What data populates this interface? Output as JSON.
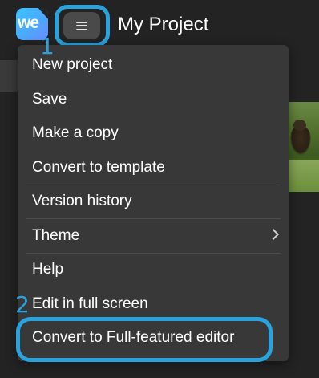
{
  "app": {
    "logo_text": "we",
    "project_title": "My Project"
  },
  "colors": {
    "accent": "#29a3de",
    "menu_bg": "#383838",
    "page_bg": "#232323"
  },
  "annotations": {
    "step1": "1",
    "step2": "2"
  },
  "menu": {
    "items": [
      {
        "label": "New project"
      },
      {
        "label": "Save"
      },
      {
        "label": "Make a copy"
      },
      {
        "label": "Convert to template"
      },
      {
        "label": "Version history"
      },
      {
        "label": "Theme",
        "has_submenu": true,
        "icon": "chevron-right-icon"
      },
      {
        "label": "Help"
      },
      {
        "label": "Edit in full screen"
      },
      {
        "label": "Convert to Full-featured editor",
        "highlighted": true
      }
    ]
  },
  "icons": {
    "menu_button": "hamburger-menu-icon",
    "theme_submenu": "chevron-right-icon"
  }
}
